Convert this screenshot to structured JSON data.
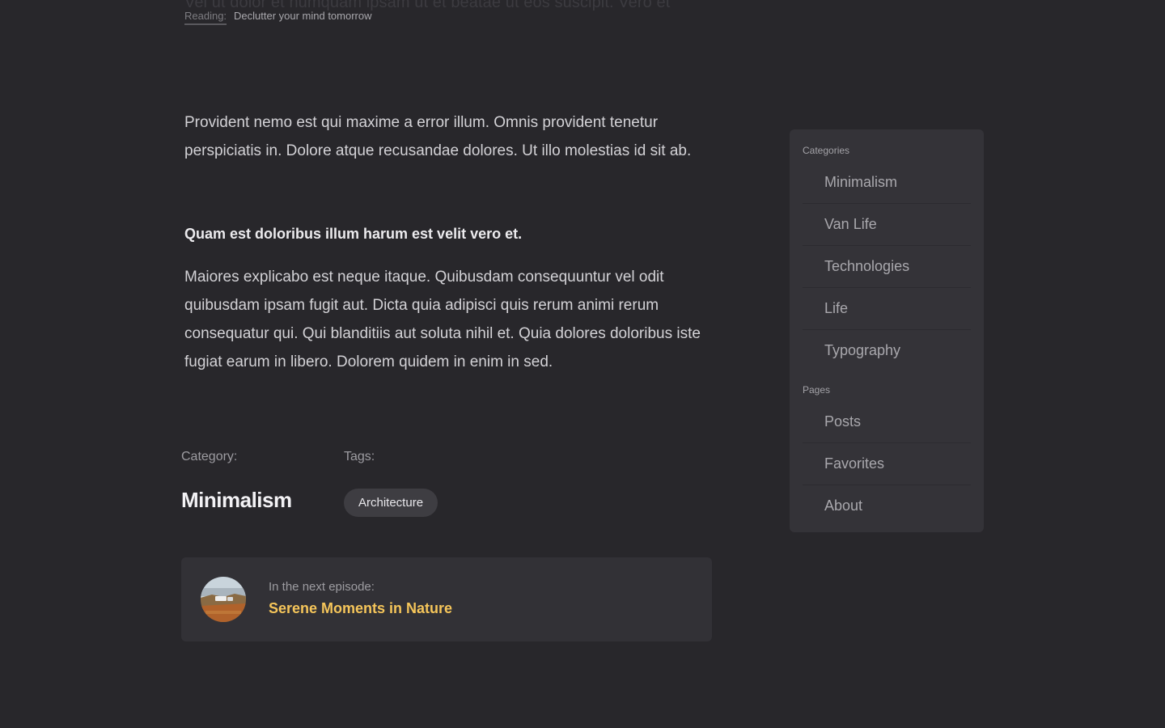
{
  "reading_bar": {
    "ghost_text": "Vel ut dolor et numquam ipsam ut et beatae ut eos suscipit. Vero et",
    "label": "Reading:",
    "title": "Declutter your mind tomorrow"
  },
  "article": {
    "paragraph_1": "Provident nemo est qui maxime a error illum. Omnis provident tenetur perspiciatis in. Dolore atque recusandae dolores. Ut illo molestias id sit ab.",
    "subheading": "Quam est doloribus illum harum est velit vero et.",
    "paragraph_2": "Maiores explicabo est neque itaque. Quibusdam consequuntur vel odit quibusdam ipsam fugit aut. Dicta quia adipisci quis rerum animi rerum consequatur qui. Qui blanditiis aut soluta nihil et. Quia dolores doloribus iste fugiat earum in libero. Dolorem quidem in enim in sed."
  },
  "meta": {
    "category_label": "Category:",
    "category_value": "Minimalism",
    "tags_label": "Tags:",
    "tags": [
      "Architecture"
    ]
  },
  "next_episode": {
    "label": "In the next episode:",
    "title": "Serene Moments in Nature"
  },
  "sidebar": {
    "categories_heading": "Categories",
    "categories": [
      "Minimalism",
      "Van Life",
      "Technologies",
      "Life",
      "Typography"
    ],
    "pages_heading": "Pages",
    "pages": [
      "Posts",
      "Favorites",
      "About"
    ]
  },
  "colors": {
    "background": "#28272b",
    "panel": "#343338",
    "accent": "#f5c55a"
  }
}
